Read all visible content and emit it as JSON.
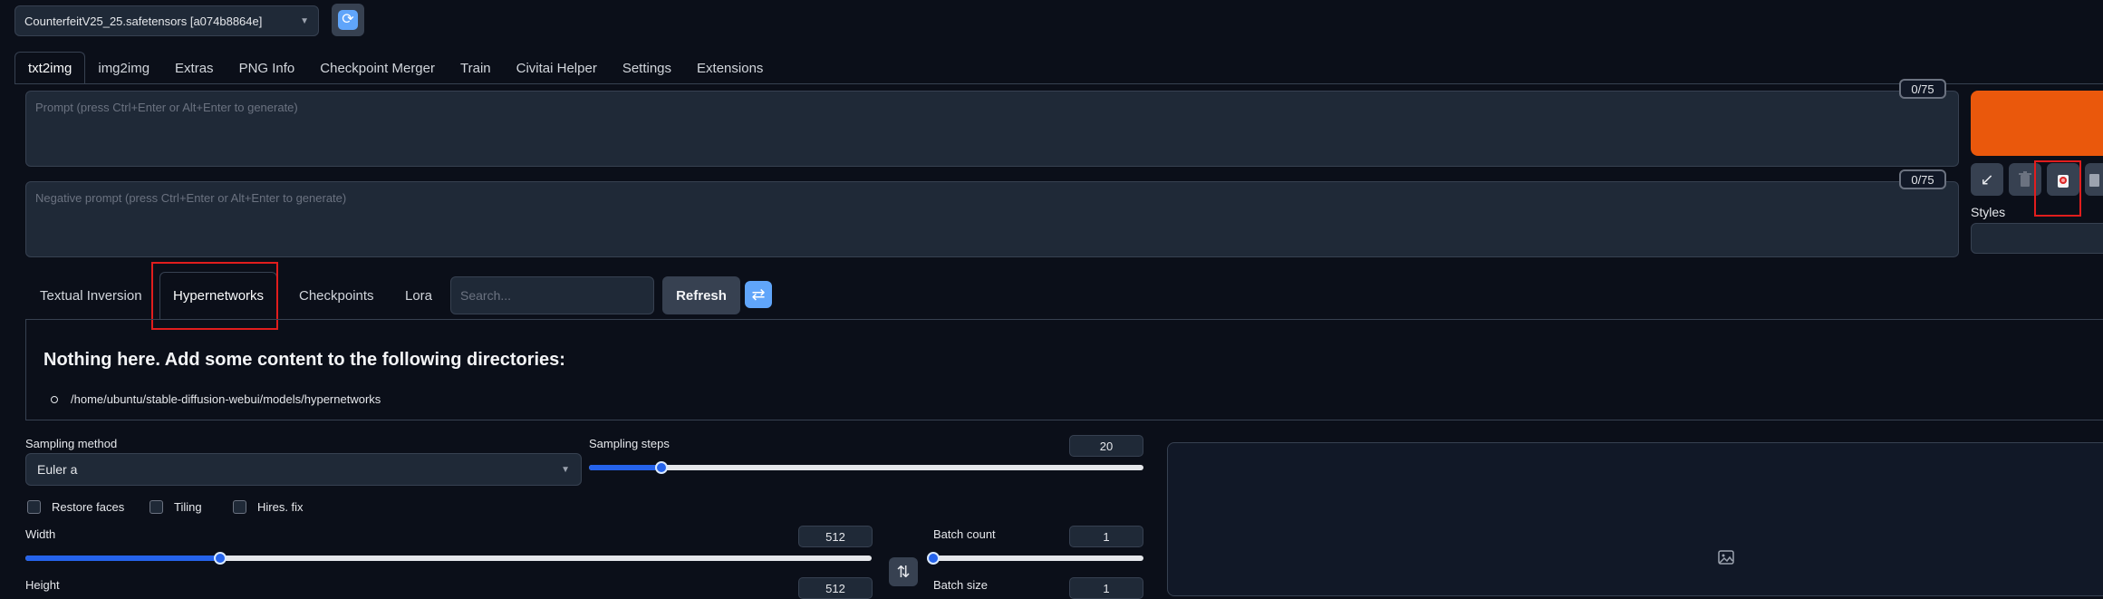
{
  "model": {
    "checkpoint_value": "CounterfeitV25_25.safetensors [a074b8864e]",
    "refresh_icon": "cycle-arrows-icon"
  },
  "main_tabs": [
    {
      "label": "txt2img",
      "active": true
    },
    {
      "label": "img2img"
    },
    {
      "label": "Extras"
    },
    {
      "label": "PNG Info"
    },
    {
      "label": "Checkpoint Merger"
    },
    {
      "label": "Train"
    },
    {
      "label": "Civitai Helper"
    },
    {
      "label": "Settings"
    },
    {
      "label": "Extensions"
    }
  ],
  "prompt": {
    "placeholder": "Prompt (press Ctrl+Enter or Alt+Enter to generate)",
    "token_counter": "0/75"
  },
  "negative_prompt": {
    "placeholder": "Negative prompt (press Ctrl+Enter or Alt+Enter to generate)",
    "token_counter": "0/75"
  },
  "toolbar": {
    "generate_color": "#ea580c",
    "buttons": [
      "read-params-arrow-icon",
      "trash-icon",
      "show-extra-networks-icon",
      "clipboard-icon"
    ],
    "styles_label": "Styles"
  },
  "extra_networks": {
    "tabs": [
      {
        "label": "Textual Inversion"
      },
      {
        "label": "Hypernetworks",
        "active": true
      },
      {
        "label": "Checkpoints"
      },
      {
        "label": "Lora"
      }
    ],
    "search_placeholder": "Search...",
    "refresh_label": "Refresh",
    "empty_title": "Nothing here. Add some content to the following directories:",
    "directory": "/home/ubuntu/stable-diffusion-webui/models/hypernetworks"
  },
  "settings": {
    "sampling_method": {
      "label": "Sampling method",
      "value": "Euler a"
    },
    "sampling_steps": {
      "label": "Sampling steps",
      "value": "20",
      "fraction": 0.13
    },
    "checkboxes": [
      {
        "label": "Restore faces",
        "checked": false
      },
      {
        "label": "Tiling",
        "checked": false
      },
      {
        "label": "Hires. fix",
        "checked": false
      }
    ],
    "width": {
      "label": "Width",
      "value": "512",
      "fraction": 0.23
    },
    "height": {
      "label": "Height",
      "value": "512"
    },
    "batch_count": {
      "label": "Batch count",
      "value": "1",
      "fraction": 0.0
    },
    "batch_size": {
      "label": "Batch size",
      "value": "1"
    }
  },
  "colors": {
    "background": "#0b0f19",
    "panel": "#1f2937",
    "accent": "#2563eb",
    "highlight_box": "#e11d1d"
  }
}
